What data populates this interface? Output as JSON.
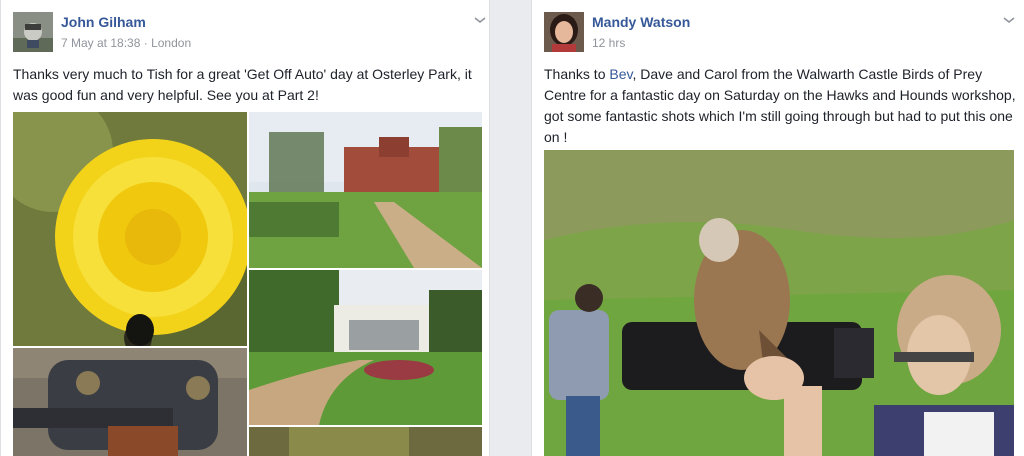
{
  "posts": [
    {
      "author": "John Gilham",
      "timestamp": "7 May at 18:38",
      "separator": "·",
      "location": "London",
      "text": "Thanks very much to Tish for a great 'Get Off Auto' day at Osterley Park, it was good fun and very helpful. See you at Part 2!"
    },
    {
      "author": "Mandy Watson",
      "timestamp": "12 hrs",
      "text_prefix": "Thanks to ",
      "mention": "Bev",
      "text_suffix": ", Dave and Carol from the Walwarth Castle Birds of Prey Centre for a fantastic day on Saturday on the Hawks and Hounds workshop, got some fantastic shots which I'm still going through but had to put this one on !"
    }
  ],
  "icons": {
    "options": "chevron-down-icon"
  },
  "colors": {
    "author": "#365899",
    "meta": "#90949c",
    "text": "#1d2129",
    "feed_bg": "#e9ebee"
  }
}
